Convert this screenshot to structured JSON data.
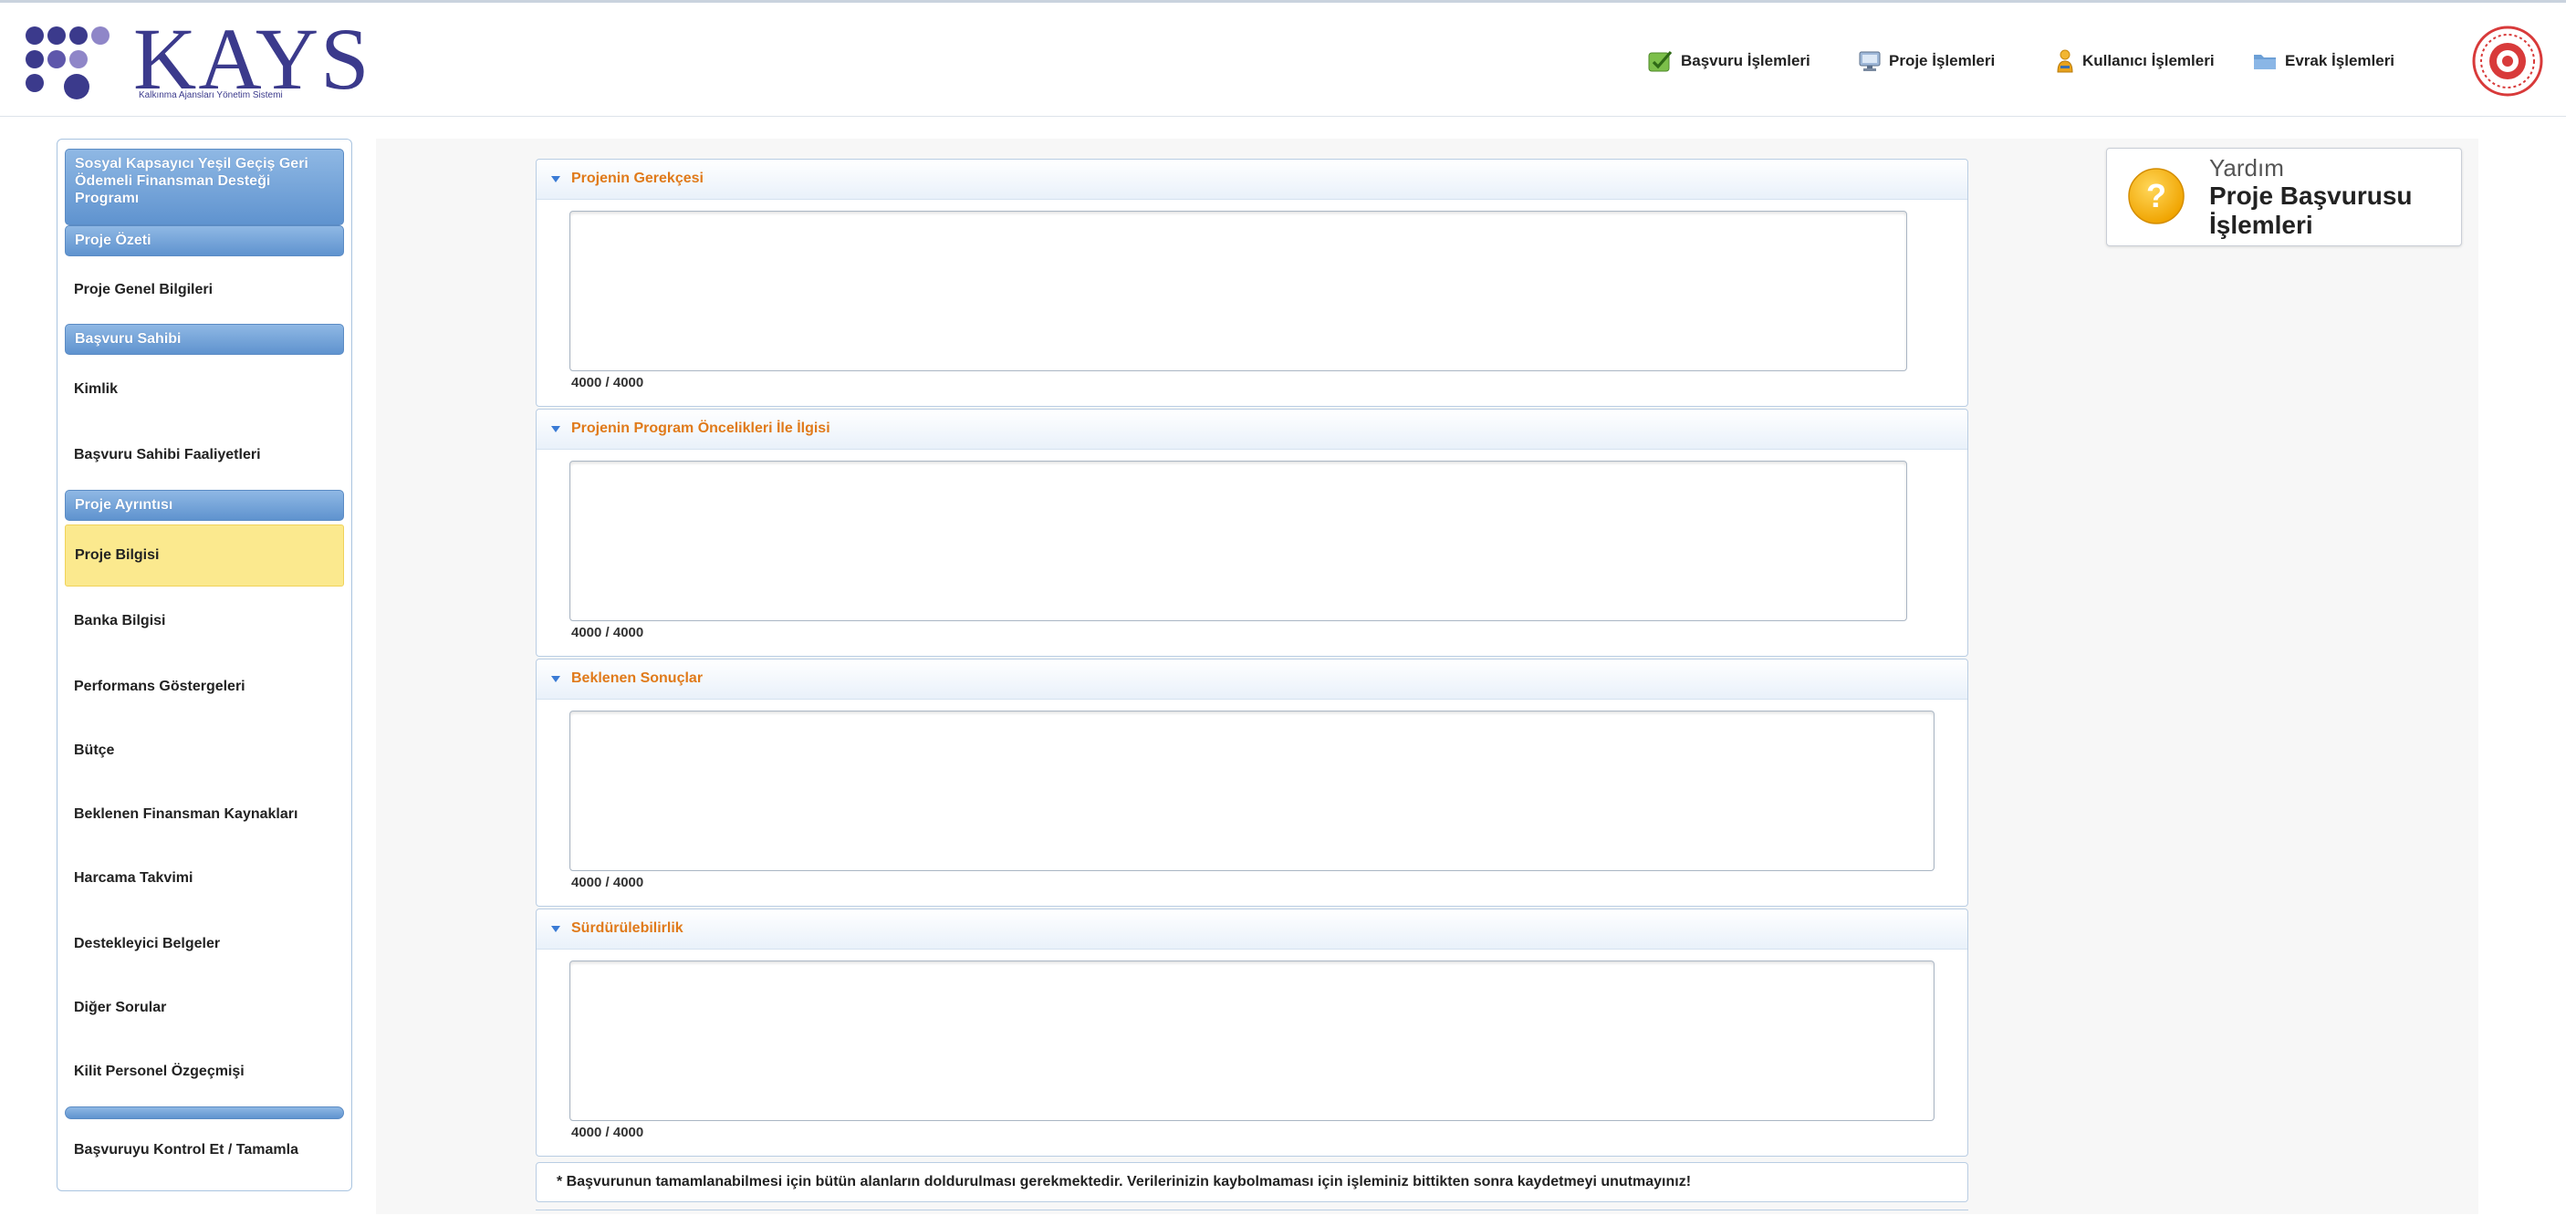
{
  "header": {
    "logo_text": "KAYS",
    "logo_subtitle": "Kalkınma Ajansları Yönetim Sistemi",
    "nav": [
      {
        "label": "Başvuru İşlemleri",
        "icon": "check-icon"
      },
      {
        "label": "Proje İşlemleri",
        "icon": "monitor-icon"
      },
      {
        "label": "Kullanıcı İşlemleri",
        "icon": "user-icon"
      },
      {
        "label": "Evrak İşlemleri",
        "icon": "folder-icon"
      }
    ],
    "seal_icon": "ministry-seal-icon"
  },
  "sidebar": {
    "program_title": "Sosyal Kapsayıcı Yeşil Geçiş Geri Ödemeli Finansman Desteği Programı",
    "sections": [
      {
        "label": "Proje Özeti",
        "items": [
          "Proje Genel Bilgileri"
        ]
      },
      {
        "label": "Başvuru Sahibi",
        "items": [
          "Kimlik",
          "Başvuru Sahibi Faaliyetleri"
        ]
      },
      {
        "label": "Proje Ayrıntısı",
        "items": [
          "Proje Bilgisi",
          "Banka Bilgisi",
          "Performans Göstergeleri",
          "Bütçe",
          "Beklenen Finansman Kaynakları",
          "Harcama Takvimi",
          "Destekleyici Belgeler",
          "Diğer Sorular",
          "Kilit Personel Özgeçmişi"
        ]
      }
    ],
    "active_item": "Proje Bilgisi",
    "final_item": "Başvuruyu Kontrol Et / Tamamla"
  },
  "panels": [
    {
      "title": "Projenin Gerekçesi",
      "value": "",
      "counter": "4000 / 4000"
    },
    {
      "title": "Projenin Program Öncelikleri İle İlgisi",
      "value": "",
      "counter": "4000 / 4000"
    },
    {
      "title": "Beklenen Sonuçlar",
      "value": "",
      "counter": "4000 / 4000"
    },
    {
      "title": "Sürdürülebilirlik",
      "value": "",
      "counter": "4000 / 4000"
    }
  ],
  "notice": "* Başvurunun tamamlanabilmesi için bütün alanların doldurulması gerekmektedir. Verilerinizin kaybolmaması için işleminiz bittikten sonra kaydetmeyi unutmayınız!",
  "help": {
    "label": "Yardım",
    "title": "Proje Başvurusu İşlemleri",
    "icon": "question-icon"
  },
  "colors": {
    "accent_blue": "#5f93cf",
    "panel_title_orange": "#e07a1a",
    "active_yellow": "#fbe98e",
    "logo_purple": "#3b3a8c"
  }
}
